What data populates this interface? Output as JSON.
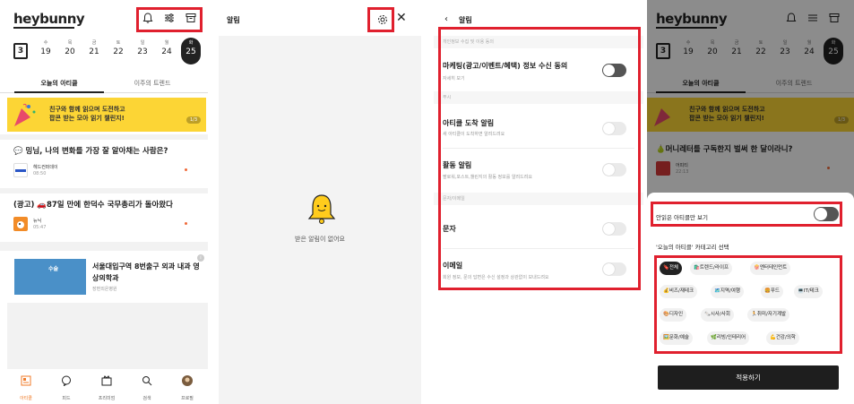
{
  "p1": {
    "logo": "heybunny",
    "calendar": {
      "icon_num": "3",
      "days": [
        {
          "dw": "수",
          "dn": "19"
        },
        {
          "dw": "목",
          "dn": "20"
        },
        {
          "dw": "금",
          "dn": "21"
        },
        {
          "dw": "토",
          "dn": "22"
        },
        {
          "dw": "일",
          "dn": "23"
        },
        {
          "dw": "월",
          "dn": "24"
        },
        {
          "dw": "화",
          "dn": "25"
        }
      ]
    },
    "tabs": [
      "오늘의 아티클",
      "이주의 트렌드"
    ],
    "banner": {
      "line1": "친구와 함께 읽으며 도전하고",
      "line2": "팝콘 받는 모아 읽기 챌린지!",
      "page": "1/3"
    },
    "articles": [
      {
        "title": "💬 밍님, 나의 변화를 가장 잘 알아채는 사람은?",
        "source": "헤드컨퍼데이",
        "time": "08:50"
      },
      {
        "title": "(광고) 🚗87일 만에 한덕수 국무총리가 돌아왔다",
        "source": "뉴닉",
        "time": "05:47"
      }
    ],
    "ad": {
      "img_text": "수술",
      "title": "서울대입구역 8번출구 외과 내과 영상의학과",
      "sub": "장편외온병원",
      "info": "i"
    },
    "nav": [
      "아티클",
      "피드",
      "프리미엄",
      "검색",
      "프로필"
    ]
  },
  "p2": {
    "title": "알림",
    "close": "✕",
    "empty_msg": "받은 알림이 없어요"
  },
  "p3": {
    "title": "알림",
    "back": "‹",
    "sections": [
      {
        "label": "개인정보 수집 및 이용 동의"
      },
      {
        "label": "푸시"
      },
      {
        "label": "문자/이메일"
      }
    ],
    "rows": [
      {
        "title": "마케팅(광고/이벤트/혜택) 정보 수신 동의",
        "sub": "자세히 보기",
        "on": true
      },
      {
        "title": "아티클 도착 알림",
        "sub": "새 아티클이 도착하면 알려드려요",
        "on": false
      },
      {
        "title": "활동 알림",
        "sub": "팔로워,포스트,챌린지의 활동 정보를 알려드려요",
        "on": false
      },
      {
        "title": "문자",
        "sub": "",
        "on": false
      },
      {
        "title": "이메일",
        "sub": "회원 정보, 문의 답변은 수신 설정과 상관없이 보내드려요",
        "on": false
      }
    ]
  },
  "p4": {
    "logo": "heybunny",
    "tabs": [
      "오늘의 아티클",
      "이주의 트렌드"
    ],
    "banner": {
      "line1": "친구와 함께 읽으며 도전하고",
      "line2": "팝콘 받는 모아 읽기 챌린지!",
      "page": "1/3"
    },
    "article": {
      "title": "🍐머니레터를 구독한지 벌써 한 달이라니?",
      "source": "어피티",
      "time": "22:13"
    },
    "days": [
      {
        "dw": "수",
        "dn": "19"
      },
      {
        "dw": "목",
        "dn": "20"
      },
      {
        "dw": "금",
        "dn": "21"
      },
      {
        "dw": "토",
        "dn": "22"
      },
      {
        "dw": "일",
        "dn": "23"
      },
      {
        "dw": "월",
        "dn": "24"
      },
      {
        "dw": "화",
        "dn": "25"
      }
    ],
    "sheet": {
      "unread_label": "안읽은 아티클만 보기",
      "category_label": "'오늘의 아티클' 카테고리 선택",
      "chips": [
        "🔖전체",
        "🛍️트렌드/라이프",
        "🍿엔터테인먼트",
        "💰비즈/재테크",
        "🗺️지역/여행",
        "🍔푸드",
        "💻IT/테크",
        "🎨디자인",
        "🗞️시사/사회",
        "🏃취미/자기계발",
        "🖼️문화/예술",
        "🌿리빙/인테리어",
        "💪건강/의학"
      ],
      "apply": "적용하기"
    }
  }
}
